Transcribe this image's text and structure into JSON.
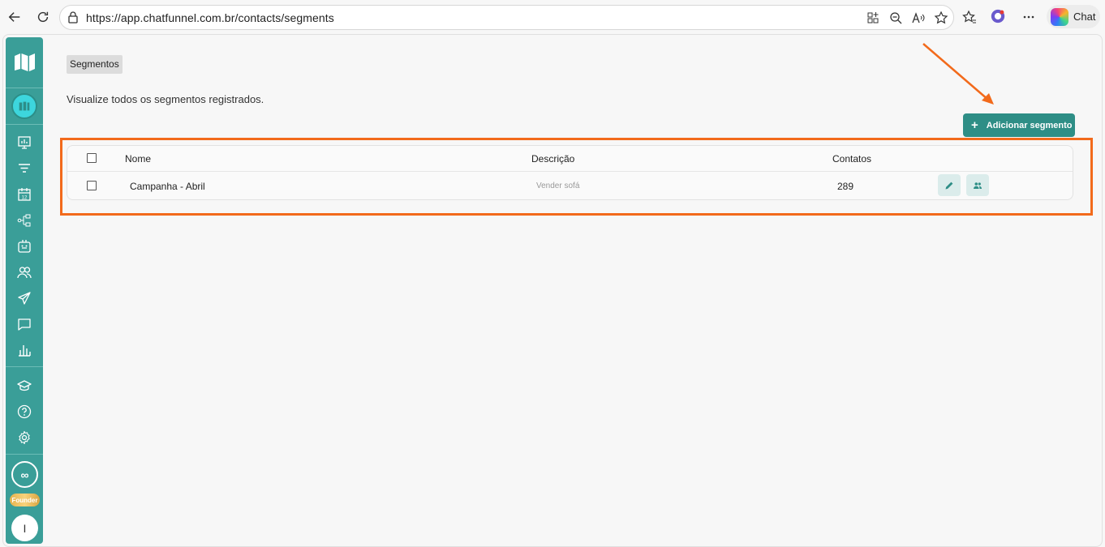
{
  "browser": {
    "url": "https://app.chatfunnel.com.br/contacts/segments",
    "chat_label": "Chat"
  },
  "sidebar": {
    "founder_badge": "Founder",
    "infinity_label": "∞",
    "user_initial": "I"
  },
  "page": {
    "breadcrumb": "Segmentos",
    "subtitle": "Visualize todos os segmentos registrados.",
    "add_button": "Adicionar segmento",
    "add_icon": "+"
  },
  "table": {
    "columns": [
      "Nome",
      "Descrição",
      "Contatos"
    ],
    "rows": [
      {
        "name": "Campanha - Abril",
        "description": "Vender sofá",
        "contacts": "289"
      }
    ]
  },
  "colors": {
    "sidebar": "#3a9e98",
    "primary_button": "#2e8e86",
    "highlight": "#f26a1b"
  }
}
